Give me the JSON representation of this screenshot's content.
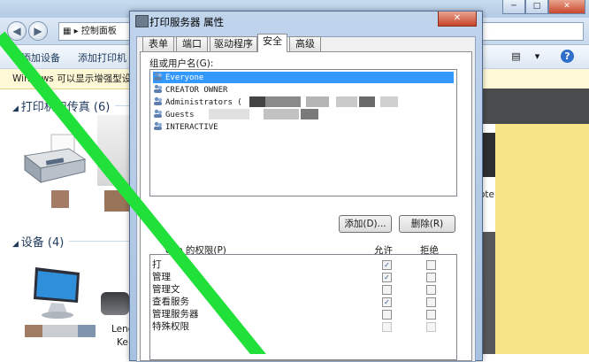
{
  "colors": {
    "accent": "#3399ff",
    "green_line": "#22e03a",
    "infobar": "#fff8d6"
  },
  "window": {
    "controls": [
      "minimize-icon",
      "maximize-icon",
      "close-icon"
    ],
    "address": "控制面板",
    "nav_back": "back-arrow-icon",
    "nav_forward": "forward-arrow-icon"
  },
  "toolbar": {
    "add_device": "添加设备",
    "add_printer": "添加打印机",
    "view_icon": "view-options-icon",
    "help_icon": "help-icon"
  },
  "infobar": {
    "text": "Windows 可以显示增强型设"
  },
  "sections": {
    "printers": "打印机和传真 (6)",
    "devices": "设备 (4)"
  },
  "background_fragments": {
    "ote": "ote",
    "lene": "Lene",
    "ke": "Ke"
  },
  "dialog": {
    "title": "打印服务器 属性",
    "close_icon": "close-icon",
    "tabs": [
      "表单",
      "端口",
      "驱动程序",
      "安全",
      "高级"
    ],
    "active_tab": "安全",
    "group_label": "组或用户名(G):",
    "users": [
      {
        "name": "Everyone",
        "selected": true
      },
      {
        "name": "CREATOR OWNER",
        "selected": false
      },
      {
        "name": "Administrators (",
        "selected": false
      },
      {
        "name": "Guests",
        "selected": false
      },
      {
        "name": "INTERACTIVE",
        "selected": false
      }
    ],
    "add_button": "添加(D)...",
    "remove_button": "删除(R)",
    "perm_label": "one 的权限(P)",
    "allow_header": "允许",
    "deny_header": "拒绝",
    "permissions": [
      {
        "name": "打",
        "allow": true,
        "allow_disabled": false,
        "deny": false
      },
      {
        "name": "管理",
        "name_suffix": "机",
        "allow": true,
        "allow_disabled": false,
        "deny": false
      },
      {
        "name": "管理文",
        "allow": false,
        "allow_disabled": false,
        "deny": false
      },
      {
        "name": "查看服务",
        "allow": true,
        "allow_disabled": false,
        "deny": false
      },
      {
        "name": "管理服务器",
        "allow": false,
        "allow_disabled": false,
        "deny": false
      },
      {
        "name": "特殊权限",
        "allow": false,
        "allow_disabled": true,
        "deny": false
      }
    ]
  }
}
